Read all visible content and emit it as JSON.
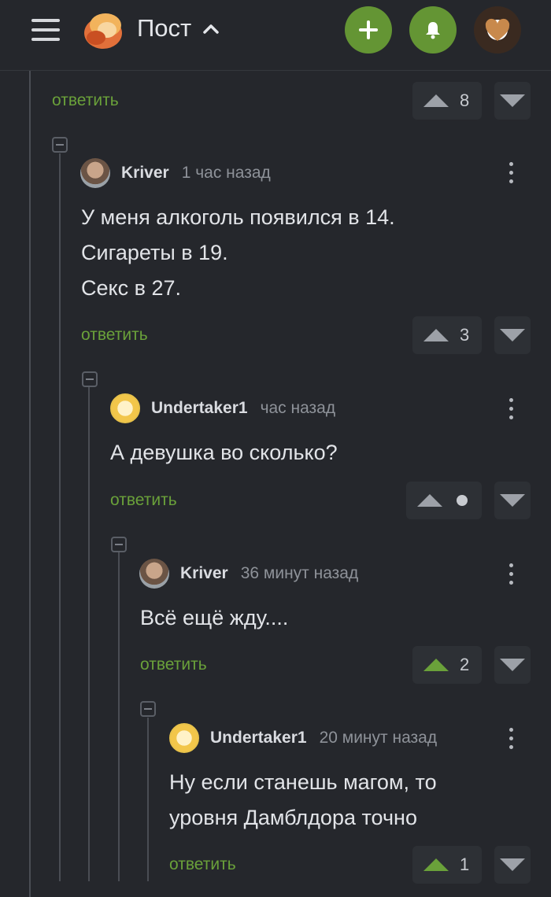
{
  "header": {
    "title": "Пост",
    "colors": {
      "accent": "#649534",
      "background": "#25272c"
    }
  },
  "comments": [
    {
      "reply_label": "ответить",
      "votes": "8"
    },
    {
      "author": "Kriver",
      "time": "1 час назад",
      "lines": [
        "У меня алкоголь появился в 14.",
        "Сигареты в 19.",
        "Секс в 27."
      ],
      "reply_label": "ответить",
      "votes": "3"
    },
    {
      "author": "Undertaker1",
      "time": "час назад",
      "lines": [
        "А девушка во сколько?"
      ],
      "reply_label": "ответить",
      "votes": ""
    },
    {
      "author": "Kriver",
      "time": "36 минут назад",
      "lines": [
        "Всё ещё жду...."
      ],
      "reply_label": "ответить",
      "votes": "2"
    },
    {
      "author": "Undertaker1",
      "time": "20 минут назад",
      "lines": [
        "Ну если станешь магом, то",
        "уровня Дамблдора точно"
      ],
      "reply_label": "ответить",
      "votes": "1"
    }
  ]
}
